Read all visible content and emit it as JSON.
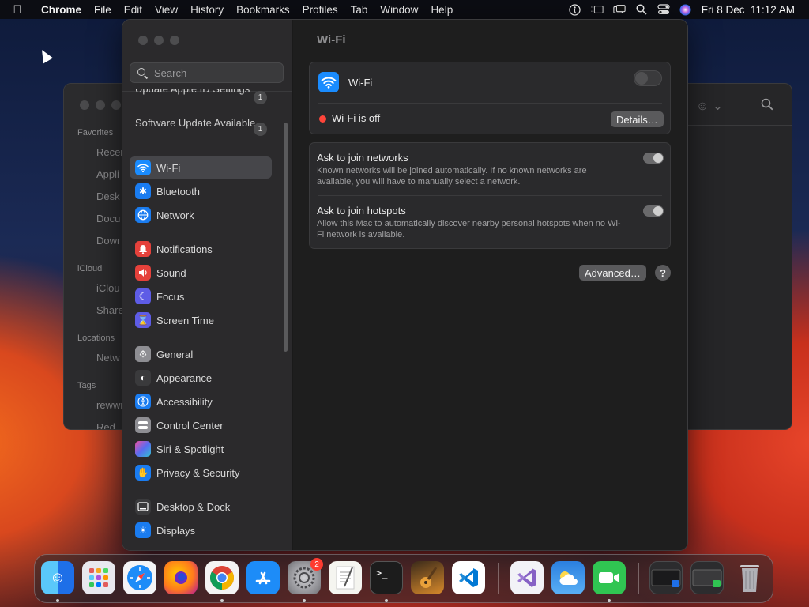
{
  "menubar": {
    "app": "Chrome",
    "items": [
      "File",
      "Edit",
      "View",
      "History",
      "Bookmarks",
      "Profiles",
      "Tab",
      "Window",
      "Help"
    ],
    "clock": "Fri 8 Dec  11:12 AM"
  },
  "finder": {
    "sections": {
      "favorites": "Favorites",
      "icloud": "iCloud",
      "locations": "Locations",
      "tags": "Tags"
    },
    "items": [
      "Recer",
      "Appli",
      "Desk",
      "Docu",
      "Dowr",
      "iClou",
      "Share",
      "Netw",
      "rewwr",
      "Red"
    ]
  },
  "settings": {
    "search_placeholder": "Search",
    "notices": [
      {
        "label": "Update Apple ID Settings",
        "count": "1"
      },
      {
        "label": "Software Update Available",
        "count": "1"
      }
    ],
    "sidebar": [
      {
        "label": "Wi-Fi",
        "icon": "wifi-icon",
        "color": "#1a8cff"
      },
      {
        "label": "Bluetooth",
        "icon": "bluetooth-icon",
        "color": "#1a7cf0"
      },
      {
        "label": "Network",
        "icon": "globe-icon",
        "color": "#1a7cf0"
      },
      {
        "label": "Notifications",
        "icon": "bell-icon",
        "color": "#e5413b"
      },
      {
        "label": "Sound",
        "icon": "speaker-icon",
        "color": "#e5413b"
      },
      {
        "label": "Focus",
        "icon": "moon-icon",
        "color": "#5e5ce6"
      },
      {
        "label": "Screen Time",
        "icon": "hourglass-icon",
        "color": "#5e5ce6"
      },
      {
        "label": "General",
        "icon": "gear-icon",
        "color": "#8e8e93"
      },
      {
        "label": "Appearance",
        "icon": "appearance-icon",
        "color": "#3a3a3c"
      },
      {
        "label": "Accessibility",
        "icon": "accessibility-icon",
        "color": "#1a7cf0"
      },
      {
        "label": "Control Center",
        "icon": "control-center-icon",
        "color": "#8e8e93"
      },
      {
        "label": "Siri & Spotlight",
        "icon": "siri-icon",
        "color": "#b44ee0"
      },
      {
        "label": "Privacy & Security",
        "icon": "hand-icon",
        "color": "#1a7cf0"
      },
      {
        "label": "Desktop & Dock",
        "icon": "desktop-icon",
        "color": "#3a3a3c"
      },
      {
        "label": "Displays",
        "icon": "display-icon",
        "color": "#1a7cf0"
      }
    ],
    "main": {
      "title": "Wi-Fi",
      "wifi_label": "Wi-Fi",
      "wifi_status": "Wi-Fi is off",
      "details_button": "Details…",
      "ask_networks_title": "Ask to join networks",
      "ask_networks_desc": "Known networks will be joined automatically. If no known networks are available, you will have to manually select a network.",
      "ask_hotspots_title": "Ask to join hotspots",
      "ask_hotspots_desc": "Allow this Mac to automatically discover nearby personal hotspots when no Wi-Fi network is available.",
      "advanced_button": "Advanced…",
      "help_button": "?"
    }
  },
  "dock": {
    "apps": [
      {
        "name": "Finder",
        "icon": "finder-icon",
        "color": "#1e90ff",
        "running": true
      },
      {
        "name": "Launchpad",
        "icon": "launchpad-icon",
        "color": "#e8e8ee",
        "running": false
      },
      {
        "name": "Safari",
        "icon": "safari-icon",
        "color": "#1d8cf8",
        "running": false
      },
      {
        "name": "Firefox",
        "icon": "firefox-icon",
        "color": "#ff7b1c",
        "running": false
      },
      {
        "name": "Chrome",
        "icon": "chrome-icon",
        "color": "#f4f4f4",
        "running": true
      },
      {
        "name": "App Store",
        "icon": "app-store-icon",
        "color": "#1d8cf8",
        "running": false
      },
      {
        "name": "System Settings",
        "icon": "settings-icon",
        "color": "#8e8e93",
        "running": true,
        "badge": "2"
      },
      {
        "name": "TextEdit",
        "icon": "textedit-icon",
        "color": "#f5f5f0",
        "running": false
      },
      {
        "name": "Terminal",
        "icon": "terminal-icon",
        "color": "#1c1c1c",
        "running": true
      },
      {
        "name": "Instruments",
        "icon": "guitar-icon",
        "color": "#d98a2b",
        "running": false
      },
      {
        "name": "VS Code",
        "icon": "vscode-icon",
        "color": "#ffffff",
        "running": false
      },
      {
        "name": "Visual Studio",
        "icon": "visual-studio-icon",
        "color": "#f2f2f7",
        "running": false
      },
      {
        "name": "Weather",
        "icon": "weather-icon",
        "color": "#2b7fe0",
        "running": false
      },
      {
        "name": "FaceTime",
        "icon": "facetime-icon",
        "color": "#30c552",
        "running": true
      },
      {
        "name": "Window 1",
        "icon": "minimized-window-icon",
        "color": "#2c2c2e",
        "running": false
      },
      {
        "name": "Window 2",
        "icon": "minimized-window-icon",
        "color": "#2c2c2e",
        "running": false
      },
      {
        "name": "Trash",
        "icon": "trash-icon",
        "color": "#9a9aa0",
        "running": false
      }
    ]
  }
}
